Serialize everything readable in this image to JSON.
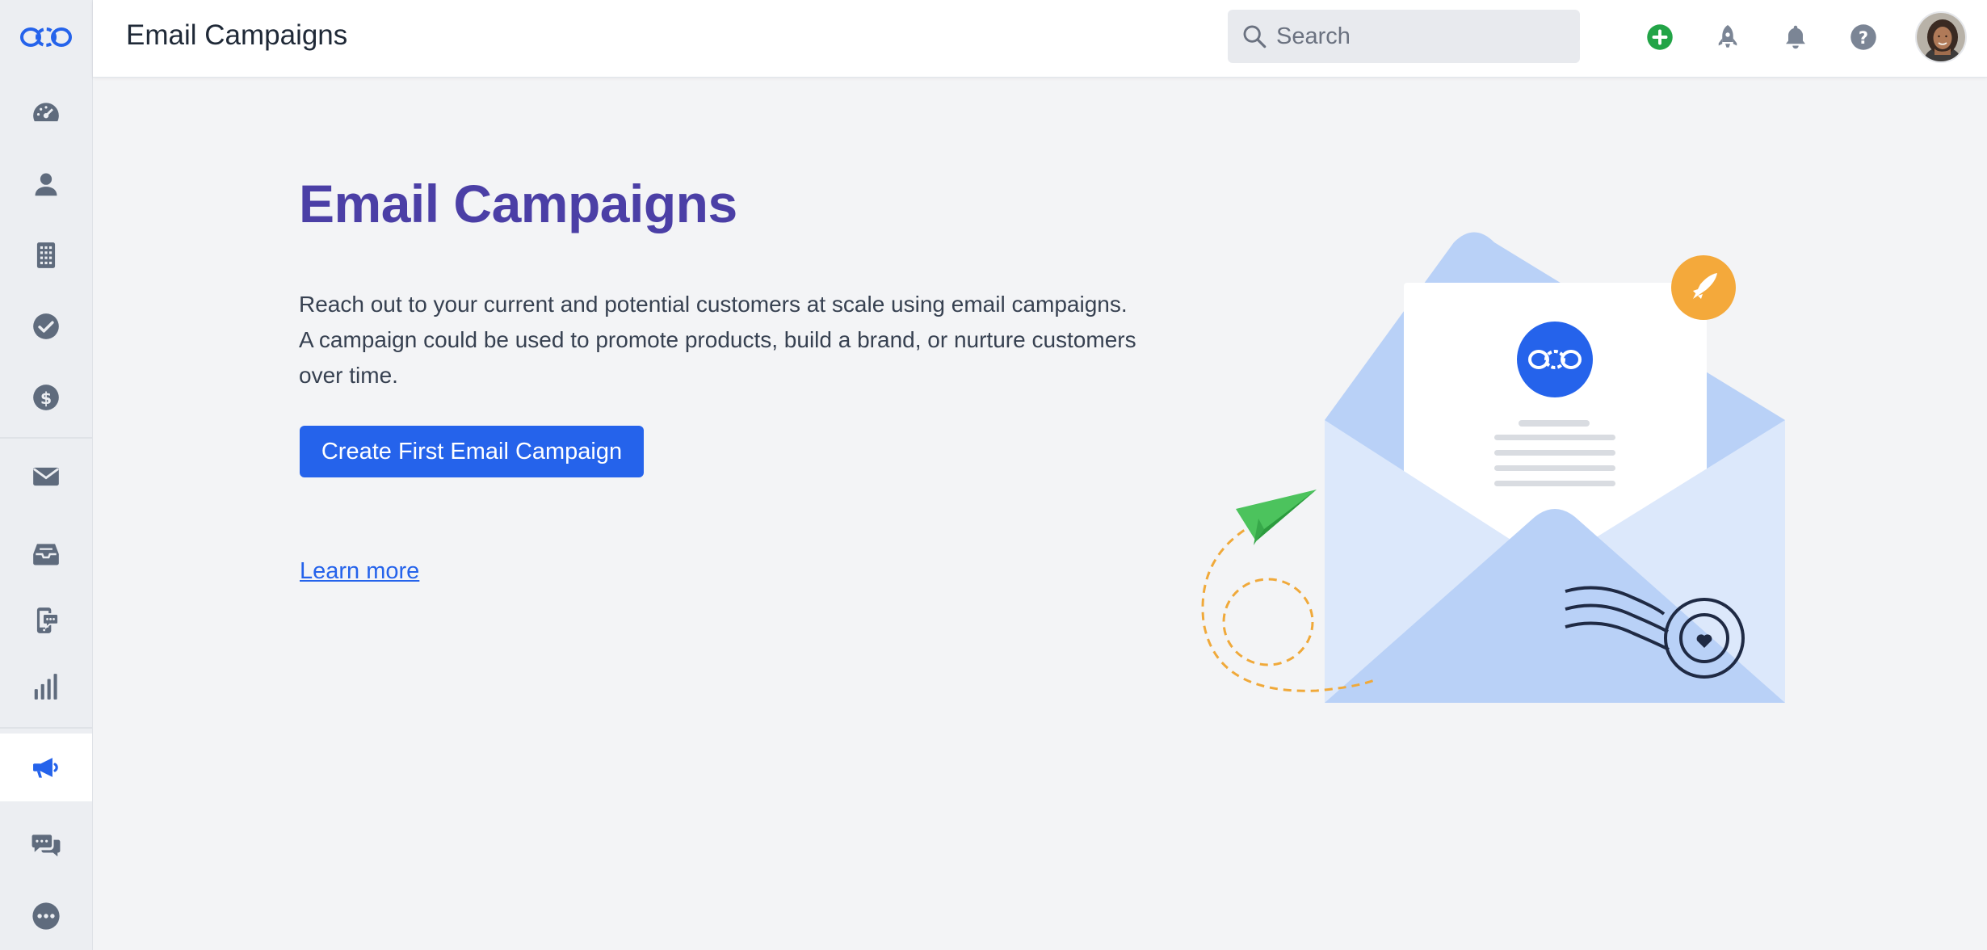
{
  "app": {
    "logo_icon": "chain-link-logo",
    "accent_color": "#2563eb",
    "heading_color": "#4b3fa6"
  },
  "sidebar": {
    "items": [
      {
        "name": "dashboard",
        "icon": "speedometer-icon"
      },
      {
        "name": "contacts",
        "icon": "person-icon"
      },
      {
        "name": "companies",
        "icon": "building-icon"
      },
      {
        "name": "tasks",
        "icon": "check-circle-icon"
      },
      {
        "name": "deals",
        "icon": "dollar-circle-icon"
      },
      {
        "name": "email",
        "icon": "envelope-icon"
      },
      {
        "name": "inbox",
        "icon": "inbox-tray-icon"
      },
      {
        "name": "phone",
        "icon": "phone-chat-icon"
      },
      {
        "name": "reports",
        "icon": "bar-chart-icon"
      },
      {
        "name": "campaigns",
        "icon": "megaphone-icon",
        "active": true
      },
      {
        "name": "conversations",
        "icon": "chat-bubbles-icon"
      },
      {
        "name": "more",
        "icon": "ellipsis-circle-icon"
      }
    ]
  },
  "header": {
    "title": "Email Campaigns",
    "search": {
      "placeholder": "Search",
      "value": ""
    },
    "icons": [
      "plus-circle-icon",
      "rocket-icon",
      "bell-icon",
      "question-circle-icon"
    ],
    "add_color": "#22a447"
  },
  "main": {
    "heading": "Email Campaigns",
    "description": "Reach out to your current and potential customers at scale using email campaigns. A campaign could be used to promote products, build a brand, or nurture customers over time.",
    "cta_label": "Create First Email Campaign",
    "learn_more": "Learn more"
  }
}
